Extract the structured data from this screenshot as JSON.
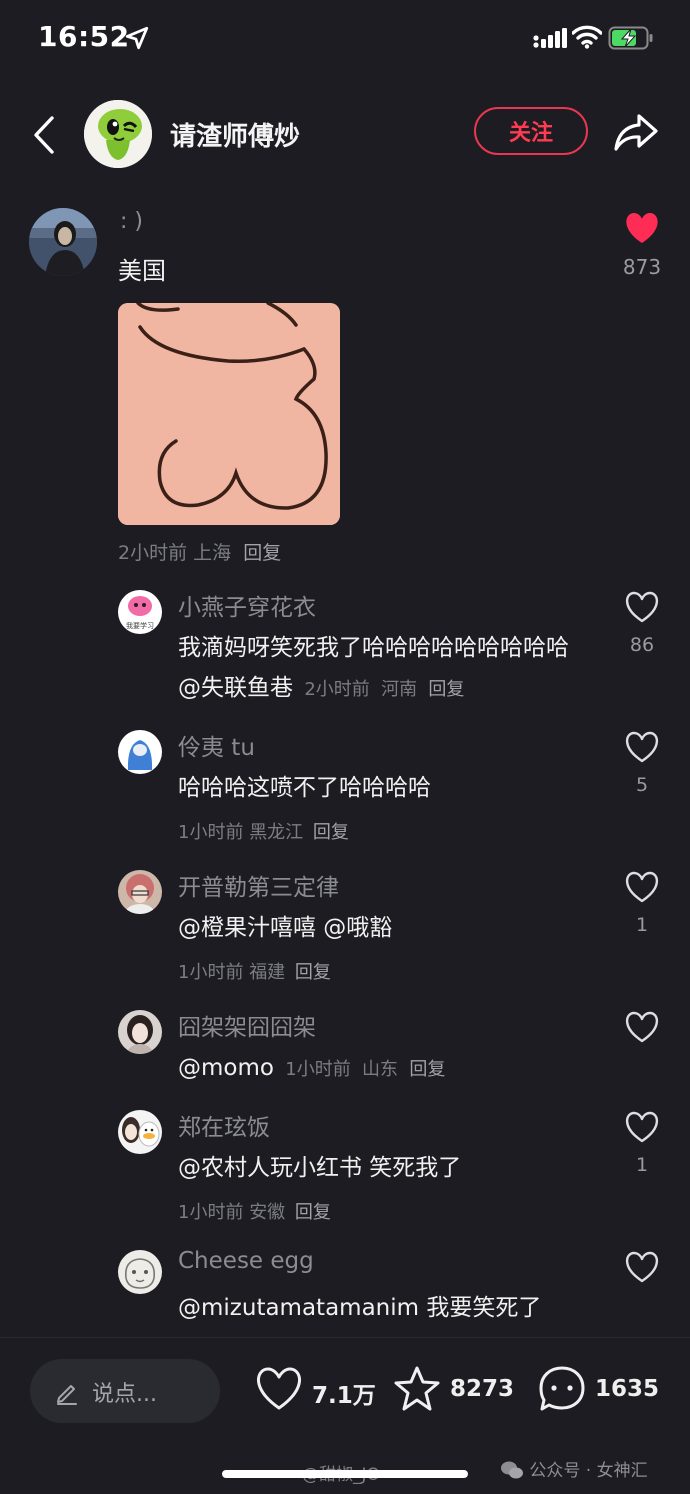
{
  "status_bar": {
    "time": "16:52"
  },
  "header": {
    "author_name": "请渣师傅炒",
    "follow_label": "关注"
  },
  "main_comment": {
    "username": ": )",
    "text": "美国",
    "like_count": "873",
    "time": "2小时前",
    "location": "上海",
    "reply_label": "回复"
  },
  "replies": [
    {
      "username": "小燕子穿花衣",
      "text": "我滴妈呀笑死我了哈哈哈哈哈哈哈哈哈",
      "mention": "@失联鱼巷",
      "time": "2小时前",
      "location": "河南",
      "reply_label": "回复",
      "like_count": "86",
      "avatar_caption": "我要学习"
    },
    {
      "username": "伶夷 tu",
      "text": "哈哈哈这喷不了哈哈哈哈",
      "time": "1小时前",
      "location": "黑龙江",
      "reply_label": "回复",
      "like_count": "5"
    },
    {
      "username": "开普勒第三定律",
      "text": "@橙果汁嘻嘻 @哦豁",
      "time": "1小时前",
      "location": "福建",
      "reply_label": "回复",
      "like_count": "1"
    },
    {
      "username": "囧架架囧囧架",
      "mention": "@momo",
      "time": "1小时前",
      "location": "山东",
      "reply_label": "回复",
      "like_count": ""
    },
    {
      "username": "郑在玹饭",
      "text": "@农村人玩小红书 笑死我了",
      "time": "1小时前",
      "location": "安徽",
      "reply_label": "回复",
      "like_count": "1"
    },
    {
      "username": "Cheese egg",
      "text": "@mizutamatamanim 我要笑死了",
      "like_count": ""
    }
  ],
  "bottom_bar": {
    "input_placeholder": "说点...",
    "likes": "7.1万",
    "favorites": "8273",
    "comments": "1635"
  },
  "watermarks": {
    "weibo": "@甜椒_JO",
    "wechat": "公众号 · 女神汇"
  },
  "colors": {
    "background": "#1c1c22",
    "accent_red": "#ff3b52",
    "liked_heart": "#ff2d55",
    "battery_green": "#4cd964"
  }
}
